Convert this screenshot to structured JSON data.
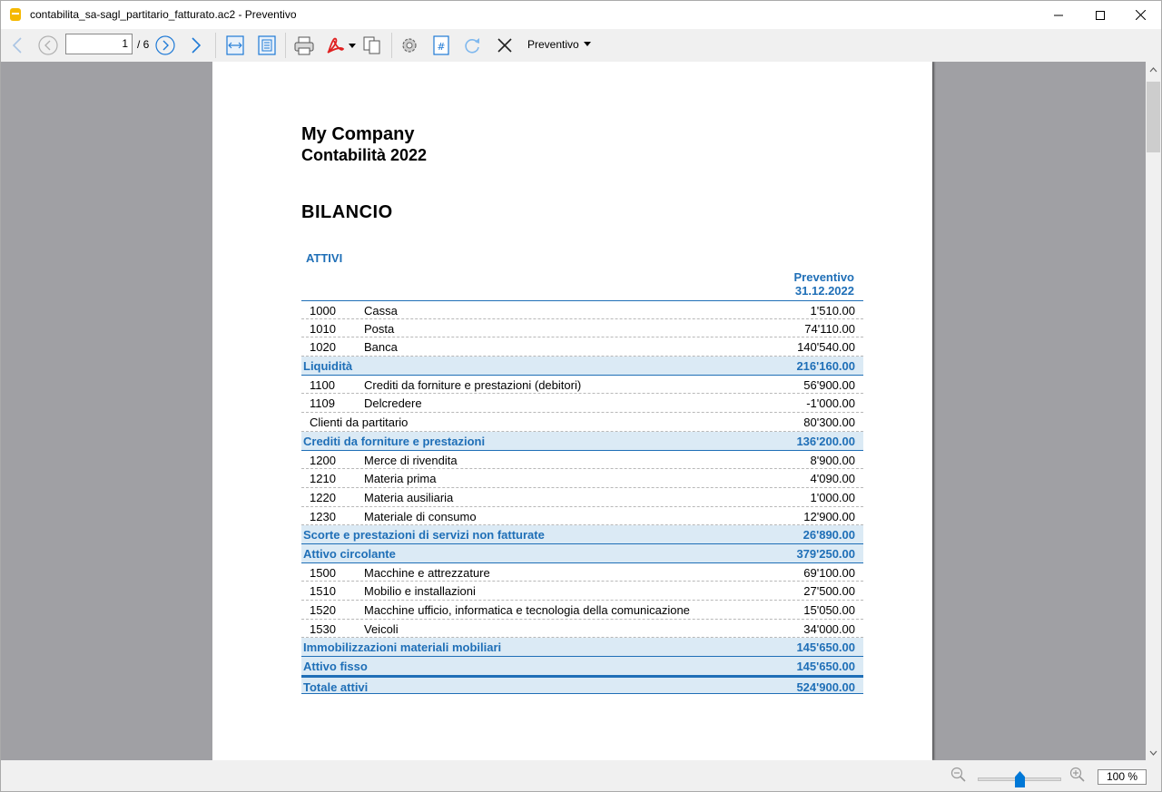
{
  "window": {
    "title": "contabilita_sa-sagl_partitario_fatturato.ac2 - Preventivo"
  },
  "toolbar": {
    "page_current": "1",
    "page_total": "/ 6",
    "view_selector": "Preventivo"
  },
  "statusbar": {
    "zoom": "100 %",
    "zoom_level_percent": 100
  },
  "report": {
    "company": "My Company",
    "subtitle": "Contabilità 2022",
    "heading": "BILANCIO",
    "section": "ATTIVI",
    "column_header_line1": "Preventivo",
    "column_header_line2": "31.12.2022",
    "rows": [
      {
        "type": "item",
        "account": "1000",
        "description": "Cassa",
        "amount": "1'510.00"
      },
      {
        "type": "item",
        "account": "1010",
        "description": "Posta",
        "amount": "74'110.00"
      },
      {
        "type": "item",
        "account": "1020",
        "description": "Banca",
        "amount": "140'540.00"
      },
      {
        "type": "total",
        "account": "",
        "description": "Liquidità",
        "amount": "216'160.00"
      },
      {
        "type": "item",
        "account": "1100",
        "description": "Crediti da forniture e prestazioni (debitori)",
        "amount": "56'900.00"
      },
      {
        "type": "item",
        "account": "1109",
        "description": "Delcredere",
        "amount": "-1'000.00"
      },
      {
        "type": "item",
        "account": "",
        "description": "Clienti da partitario",
        "amount": "80'300.00"
      },
      {
        "type": "total",
        "account": "",
        "description": "Crediti da forniture e prestazioni",
        "amount": "136'200.00"
      },
      {
        "type": "item",
        "account": "1200",
        "description": "Merce di rivendita",
        "amount": "8'900.00"
      },
      {
        "type": "item",
        "account": "1210",
        "description": "Materia prima",
        "amount": "4'090.00"
      },
      {
        "type": "item",
        "account": "1220",
        "description": "Materia ausiliaria",
        "amount": "1'000.00"
      },
      {
        "type": "item",
        "account": "1230",
        "description": "Materiale di consumo",
        "amount": "12'900.00"
      },
      {
        "type": "total",
        "account": "",
        "description": "Scorte e prestazioni di servizi non fatturate",
        "amount": "26'890.00"
      },
      {
        "type": "total",
        "account": "",
        "description": "Attivo circolante",
        "amount": "379'250.00"
      },
      {
        "type": "item",
        "account": "1500",
        "description": "Macchine e attrezzature",
        "amount": "69'100.00"
      },
      {
        "type": "item",
        "account": "1510",
        "description": "Mobilio e installazioni",
        "amount": "27'500.00"
      },
      {
        "type": "item",
        "account": "1520",
        "description": "Macchine ufficio, informatica e tecnologia della comunicazione",
        "amount": "15'050.00"
      },
      {
        "type": "item",
        "account": "1530",
        "description": "Veicoli",
        "amount": "34'000.00"
      },
      {
        "type": "total",
        "account": "",
        "description": "Immobilizzazioni materiali mobiliari",
        "amount": "145'650.00"
      },
      {
        "type": "total",
        "account": "",
        "description": "Attivo fisso",
        "amount": "145'650.00"
      },
      {
        "type": "total",
        "account": "",
        "description": "Totale attivi",
        "amount": "524'900.00"
      }
    ]
  }
}
